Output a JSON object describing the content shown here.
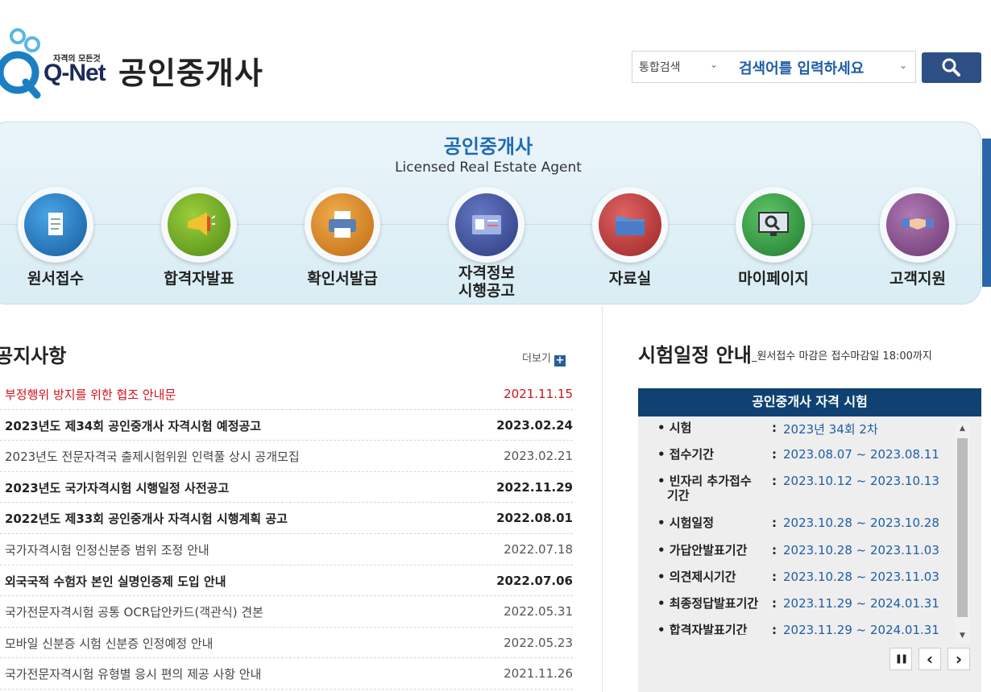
{
  "header": {
    "logo_tagline": "자격의 모든것",
    "logo_text": "Q-Net",
    "site_title": "공인중개사"
  },
  "search": {
    "category": "통합검색",
    "placeholder": "검색어를 입력하세요"
  },
  "banner": {
    "title": "공인중개사",
    "subtitle": "Licensed Real Estate Agent",
    "menu": [
      {
        "label": "원서접수",
        "icon": "document-icon",
        "color": "#1e6fb8"
      },
      {
        "label": "합격자발표",
        "icon": "megaphone-icon",
        "color": "#5f9a1e"
      },
      {
        "label": "확인서발급",
        "icon": "printer-icon",
        "color": "#d9861e"
      },
      {
        "label": "자격정보",
        "label2": "시행공고",
        "icon": "id-card-icon",
        "color": "#3c4f99"
      },
      {
        "label": "자료실",
        "icon": "folder-icon",
        "color": "#c0393a"
      },
      {
        "label": "마이페이지",
        "icon": "monitor-search-icon",
        "color": "#2f9a3e"
      },
      {
        "label": "고객지원",
        "icon": "handshake-icon",
        "color": "#8a4f8c"
      }
    ]
  },
  "notice": {
    "title": "공지사항",
    "more": "더보기",
    "items": [
      {
        "text": "부정행위 방지를 위한 협조 안내문",
        "date": "2021.11.15",
        "style": "red"
      },
      {
        "text": "2023년도 제34회 공인중개사 자격시험 예정공고",
        "date": "2023.02.24",
        "style": "bold"
      },
      {
        "text": "2023년도 전문자격국 출제시험위원 인력풀 상시 공개모집",
        "date": "2023.02.21",
        "style": "normal"
      },
      {
        "text": "2023년도 국가자격시험 시행일정 사전공고",
        "date": "2022.11.29",
        "style": "bold"
      },
      {
        "text": "2022년도 제33회 공인중개사 자격시험 시행계획 공고",
        "date": "2022.08.01",
        "style": "bold"
      },
      {
        "text": "국가자격시험 인정신분증 범위 조정 안내",
        "date": "2022.07.18",
        "style": "normal"
      },
      {
        "text": "외국국적 수험자 본인 실명인증제 도입 안내",
        "date": "2022.07.06",
        "style": "bold"
      },
      {
        "text": "국가전문자격시험 공통 OCR답안카드(객관식) 견본",
        "date": "2022.05.31",
        "style": "normal"
      },
      {
        "text": "모바일 신분증 시험 신분증 인정예정 안내",
        "date": "2022.05.23",
        "style": "normal"
      },
      {
        "text": "국가전문자격시험 유형별 응시 편의 제공 사항 안내",
        "date": "2021.11.26",
        "style": "normal"
      }
    ]
  },
  "schedule": {
    "title": "시험일정 안내",
    "note": "_원서접수 마감은 접수마감일 18:00까지",
    "box_title": "공인중개사 자격 시험",
    "rows": [
      {
        "label": "• 시험",
        "value": "2023년 34회 2차"
      },
      {
        "label": "• 접수기간",
        "value": "2023.08.07 ~ 2023.08.11"
      },
      {
        "label": "• 빈자리 추가접수",
        "label2": "기간",
        "value": "2023.10.12 ~ 2023.10.13"
      },
      {
        "label": "• 시험일정",
        "value": "2023.10.28 ~ 2023.10.28"
      },
      {
        "label": "• 가답안발표기간",
        "value": "2023.10.28 ~ 2023.11.03"
      },
      {
        "label": "• 의견제시기간",
        "value": "2023.10.28 ~ 2023.11.03"
      },
      {
        "label": "• 최종정답발표기간",
        "value": "2023.11.29 ~ 2024.01.31"
      },
      {
        "label": "• 합격자발표기간",
        "value": "2023.11.29 ~ 2024.01.31"
      }
    ],
    "controls": {
      "pause": "❚❚",
      "prev": "‹",
      "next": "›"
    }
  }
}
